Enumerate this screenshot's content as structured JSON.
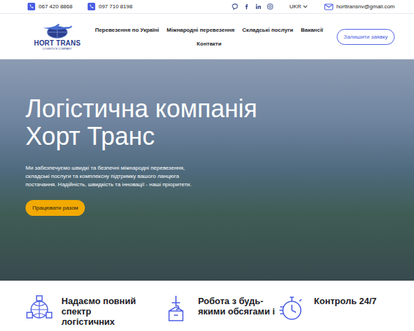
{
  "topbar": {
    "phones": [
      "067 420 8868",
      "097 710 8198"
    ],
    "language": "UKR",
    "email": "horttransnv@gmail.com"
  },
  "logo": {
    "name": "HORT TRANS",
    "tagline": "LOGISTICS COMPANY"
  },
  "nav": {
    "items": [
      "Перевезення по Україні",
      "Міжнародні перевезення",
      "Складські послуги",
      "Вакансії",
      "Контакти"
    ],
    "cta": "Залишити заявку"
  },
  "hero": {
    "title": "Логістична компанія Хорт Транс",
    "text": "Ми забезпечуємо швидкі та безпечні міжнародні перевезення, складські послуги та комплексну підтримку вашого ланцюга постачання. Надійність, швидкість та інновації - наші пріоритети.",
    "button": "Працювати разом"
  },
  "features": [
    {
      "title": "Надаємо повний спектр логістичних",
      "kind": "globe"
    },
    {
      "title": "Робота з будь-якими обсягами і",
      "kind": "crane"
    },
    {
      "title": "Контроль 24/7",
      "kind": "clock"
    }
  ]
}
